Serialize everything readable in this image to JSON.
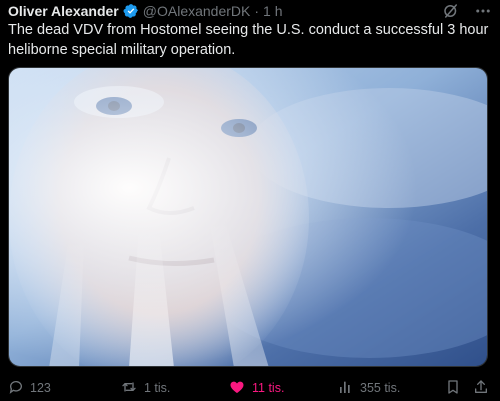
{
  "tweet": {
    "author": "Oliver Alexander",
    "handle": "@OAlexanderDK",
    "separator": "·",
    "time": "1 h",
    "text": "The dead VDV from Hostomel seeing the U.S. conduct a successful 3 hour heliborne special military operation."
  },
  "media": {
    "type": "image",
    "subject": "man's face in clouds with light rays"
  },
  "actions": {
    "reply_count": "123",
    "retweet_count": "1 tis.",
    "like_count": "11 tis.",
    "views_count": "355 tis."
  },
  "colors": {
    "background": "#000000",
    "text": "#e7e9ea",
    "secondary": "#71767b",
    "verified": "#1d9bf0",
    "like": "#f91880"
  },
  "icons": [
    "verified-badge-icon",
    "grok-icon",
    "more-icon",
    "reply-icon",
    "retweet-icon",
    "like-icon",
    "views-icon",
    "bookmark-icon",
    "share-icon"
  ]
}
